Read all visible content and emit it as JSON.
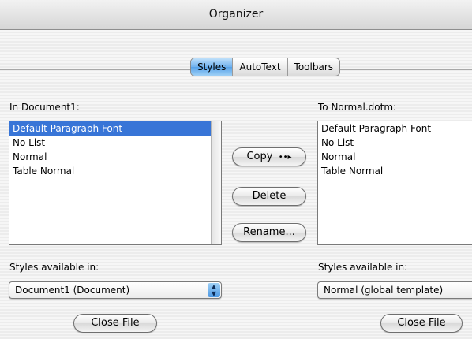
{
  "window": {
    "title": "Organizer"
  },
  "tabs": [
    {
      "label": "Styles",
      "active": true
    },
    {
      "label": "AutoText",
      "active": false
    },
    {
      "label": "Toolbars",
      "active": false
    }
  ],
  "left": {
    "heading": "In Document1:",
    "items": [
      "Default Paragraph Font",
      "No List",
      "Normal",
      "Table Normal"
    ],
    "selected_index": 0,
    "styles_label": "Styles available in:",
    "styles_value": "Document1 (Document)",
    "close_label": "Close File"
  },
  "right": {
    "heading": "To Normal.dotm:",
    "items": [
      "Default Paragraph Font",
      "No List",
      "Normal",
      "Table Normal"
    ],
    "styles_label": "Styles available in:",
    "styles_value": "Normal (global template)",
    "close_label": "Close File"
  },
  "actions": {
    "copy_label": "Copy",
    "copy_icon": "double-arrow-right-icon",
    "delete_label": "Delete",
    "rename_label": "Rename..."
  },
  "colors": {
    "selection": "#3875d7",
    "tab_active": "#6fb1ee"
  }
}
